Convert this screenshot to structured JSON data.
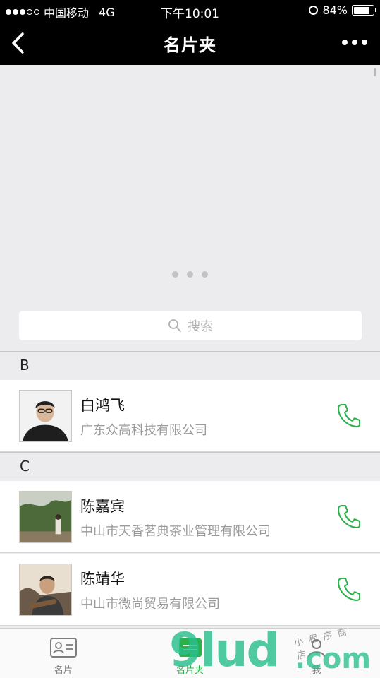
{
  "status_bar": {
    "carrier": "中国移动",
    "network": "4G",
    "time": "下午10:01",
    "battery": "84%",
    "battery_level": 0.84
  },
  "nav": {
    "title": "名片夹",
    "back_icon": "chevron-left-icon",
    "more_icon": "more-icon"
  },
  "search": {
    "placeholder": "搜索",
    "icon": "search-icon"
  },
  "contacts": [
    {
      "letter": "B",
      "items": [
        {
          "name": "白鸿飞",
          "company": "广东众高科技有限公司"
        }
      ]
    },
    {
      "letter": "C",
      "items": [
        {
          "name": "陈嘉宾",
          "company": "中山市天香茗典茶业管理有限公司"
        },
        {
          "name": "陈靖华",
          "company": "中山市微尚贸易有限公司"
        }
      ]
    }
  ],
  "tabbar": {
    "tabs": [
      {
        "label": "名片",
        "icon": "card-icon",
        "active": false
      },
      {
        "label": "名片夹",
        "icon": "card-folder-icon",
        "active": true
      },
      {
        "label": "我",
        "icon": "person-icon",
        "active": false
      }
    ]
  },
  "watermark": {
    "brand": "9lud",
    "domain": ".com",
    "tagline": "小程序商店"
  },
  "colors": {
    "nav_bg": "#000000",
    "accent_green": "#2bb14a",
    "page_bg": "#ececee"
  }
}
